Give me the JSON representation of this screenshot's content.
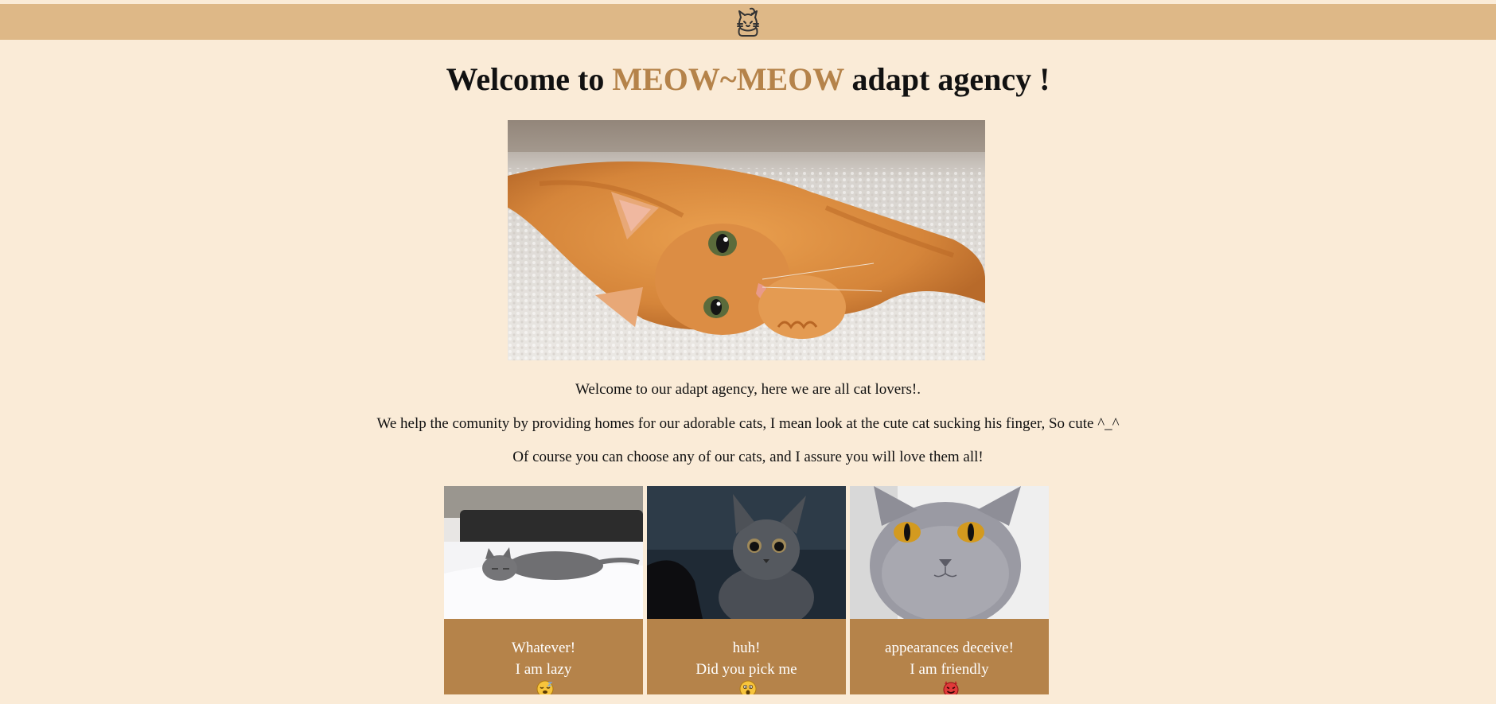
{
  "header": {
    "logo_icon": "cat-face-icon",
    "bar_color": "#deb887"
  },
  "title": {
    "prefix": "Welcome to",
    "brand": "MEOW~MEOW",
    "suffix": "adapt agency !",
    "brand_color": "#b5834a"
  },
  "hero": {
    "image": "orange-kitten-on-rug"
  },
  "intro": {
    "line1": "Welcome to our adapt agency, here we are all cat lovers!.",
    "line2": "We help the comunity by providing homes for our adorable cats, I mean look at the cute cat sucking his finger, So cute ^_^",
    "line3": "Of course you can choose any of our cats, and I assure you will love them all!"
  },
  "cards": [
    {
      "image": "gray-cat-sleeping-on-bed",
      "line1": "Whatever!",
      "line2": "I am lazy",
      "emoji": "sleeping-face-icon",
      "suffix": ""
    },
    {
      "image": "gray-kitten-staring",
      "line1": "huh!",
      "line2": "Did you pick me",
      "emoji": "astonished-face-icon",
      "suffix": "!?"
    },
    {
      "image": "british-shorthair-orange-eyes",
      "line1": "appearances deceive!",
      "line2": "I am friendly",
      "emoji": "smiling-devil-icon",
      "suffix": ""
    }
  ],
  "colors": {
    "background": "#faebd7",
    "card": "#b5834a"
  }
}
